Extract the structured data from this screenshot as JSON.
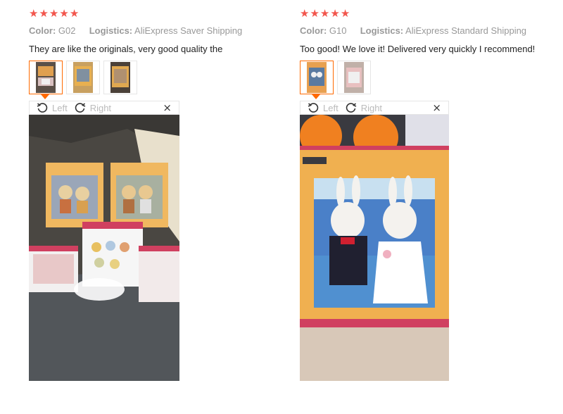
{
  "reviews": [
    {
      "rating": 5,
      "color_label": "Color:",
      "color_value": "G02",
      "logistics_label": "Logistics:",
      "logistics_value": "AliExpress Saver Shipping",
      "text": "They are like the originals, very good quality the",
      "image_count": 3,
      "active_image": 1
    },
    {
      "rating": 5,
      "color_label": "Color:",
      "color_value": "G10",
      "logistics_label": "Logistics:",
      "logistics_value": "AliExpress Standard Shipping",
      "text": "Too good! We love it! Delivered very quickly I recommend!",
      "image_count": 2,
      "active_image": 1
    }
  ],
  "viewer": {
    "rotate_left_label": "Left",
    "rotate_right_label": "Right",
    "close_glyph": "×"
  },
  "colors": {
    "star": "#f2564d",
    "active_thumb_border": "#ff6a00",
    "meta_text": "#999999"
  },
  "icons": {
    "star": "star-icon",
    "rotate_left": "rotate-left-icon",
    "rotate_right": "rotate-right-icon",
    "close": "close-icon"
  }
}
